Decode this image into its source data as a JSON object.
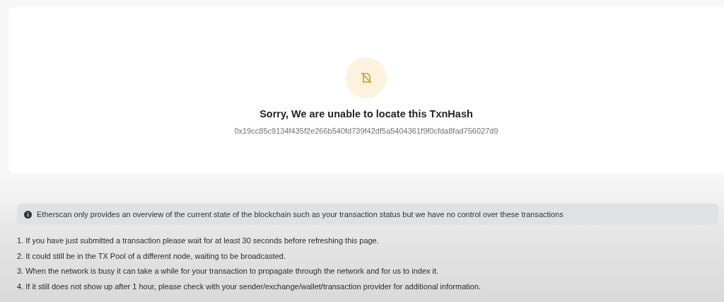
{
  "error": {
    "title": "Sorry, We are unable to locate this TxnHash",
    "hash": "0x19cc85c9134f435f2e266b540fd739f42df5a5404361f9f0cfda8fad756027d9"
  },
  "notice": {
    "text": "Etherscan only provides an overview of the current state of the blockchain such as your transaction status but we have no control over these transactions"
  },
  "tips": [
    "1. If you have just submitted a transaction please wait for at least 30 seconds before refreshing this page.",
    "2. It could still be in the TX Pool of a different node, waiting to be broadcasted.",
    "3. When the network is busy it can take a while for your transaction to propagate through the network and for us to index it.",
    "4. If it still does not show up after 1 hour, please check with your sender/exchange/wallet/transaction provider for additional information."
  ]
}
